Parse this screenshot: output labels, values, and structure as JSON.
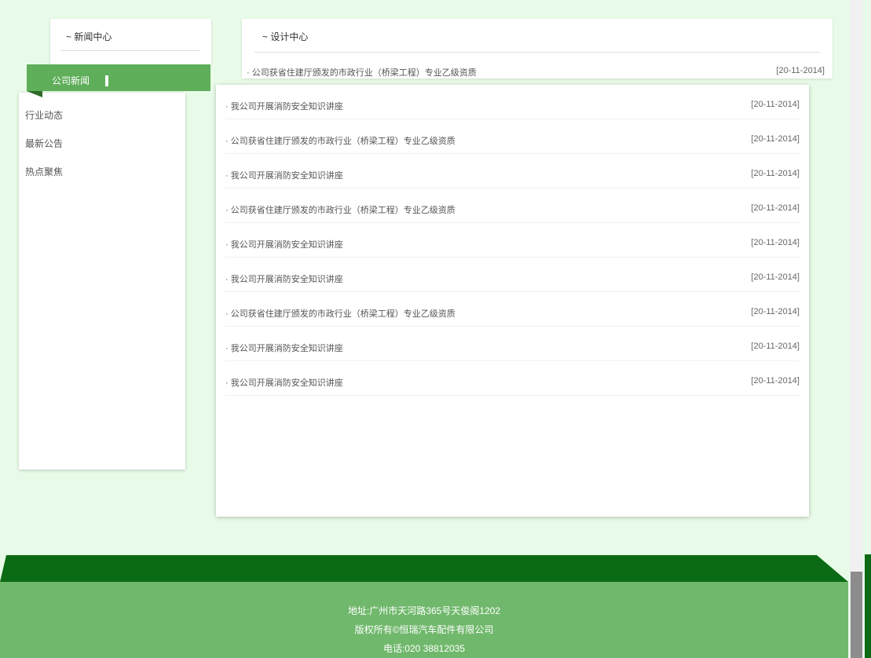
{
  "sidebar": {
    "title": "~ 新闻中心",
    "active": "公司新闻",
    "items": [
      {
        "label": "行业动态"
      },
      {
        "label": "最新公告"
      },
      {
        "label": "热点聚焦"
      }
    ]
  },
  "top_panel": {
    "title": "~ 设计中心",
    "row": {
      "title": "· 公司获省住建厅颁发的市政行业（桥梁工程）专业乙级资质",
      "date": "[20-11-2014]"
    }
  },
  "news": [
    {
      "title": "· 我公司开展消防安全知识讲座",
      "date": "[20-11-2014]"
    },
    {
      "title": "· 公司获省住建厅颁发的市政行业（桥梁工程）专业乙级资质",
      "date": "[20-11-2014]"
    },
    {
      "title": "· 我公司开展消防安全知识讲座",
      "date": "[20-11-2014]"
    },
    {
      "title": "· 公司获省住建厅颁发的市政行业（桥梁工程）专业乙级资质",
      "date": "[20-11-2014]"
    },
    {
      "title": "· 我公司开展消防安全知识讲座",
      "date": "[20-11-2014]"
    },
    {
      "title": "· 我公司开展消防安全知识讲座",
      "date": "[20-11-2014]"
    },
    {
      "title": "· 公司获省住建厅颁发的市政行业（桥梁工程）专业乙级资质",
      "date": "[20-11-2014]"
    },
    {
      "title": "· 我公司开展消防安全知识讲座",
      "date": "[20-11-2014]"
    },
    {
      "title": "· 我公司开展消防安全知识讲座",
      "date": "[20-11-2014]"
    }
  ],
  "footer": {
    "address": "地址:广州市天河路365号天俊阁1202",
    "copyright": "版权所有©恒瑞汽车配件有限公司",
    "phone": "电话:020 38812035"
  },
  "colors": {
    "accent": "#5fae5a",
    "footer_dark": "#0b6b14",
    "footer_light": "#70b86c",
    "page_bg": "#e8fbe8"
  }
}
